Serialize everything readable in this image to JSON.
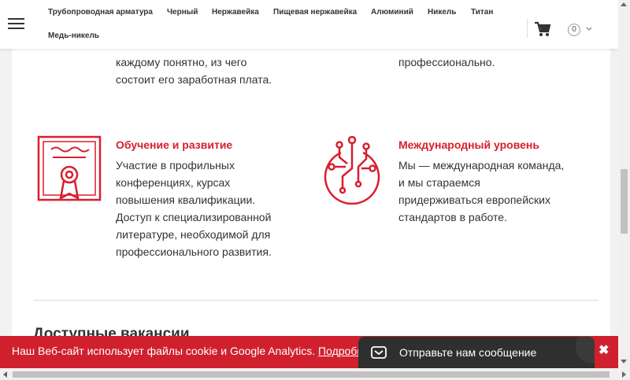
{
  "nav": {
    "links": [
      "Трубопроводная арматура",
      "Черный",
      "Нержавейка",
      "Пищевая нержавейка",
      "Алюминий",
      "Никель",
      "Титан",
      "Медь-никель"
    ],
    "cart_count": "0"
  },
  "features": {
    "salary_text": [
      "каждому понятно, из чего",
      "состоит его заработная плата."
    ],
    "professional_text": "профессионально.",
    "training": {
      "title": "Обучение и развитие",
      "text": [
        "Участие в профильных",
        "конференциях, курсах",
        "повышения квалификации.",
        "Доступ к специализированной",
        "литературе, необходимой для",
        "профессионального развития."
      ]
    },
    "international": {
      "title": "Международный уровень",
      "text": [
        "Мы — международная команда,",
        "и мы стараемся",
        "придерживаться европейских",
        "стандартов в работе."
      ]
    }
  },
  "vacancies_title": "Доступные вакансии",
  "cookie": {
    "text": "Наш Веб-сайт использует файлы cookie и Google Analytics.",
    "link": "Подробн"
  },
  "chat": {
    "label": "Отправьте нам сообщение"
  },
  "colors": {
    "accent": "#d81e2e",
    "cookie_bg": "#d0202e",
    "chat_bg": "#2f2f2f"
  },
  "icons": {
    "training": "certificate-icon",
    "international": "globe-network-icon",
    "cart": "cart-icon",
    "chat": "mail-icon",
    "menu": "burger-menu-icon"
  }
}
